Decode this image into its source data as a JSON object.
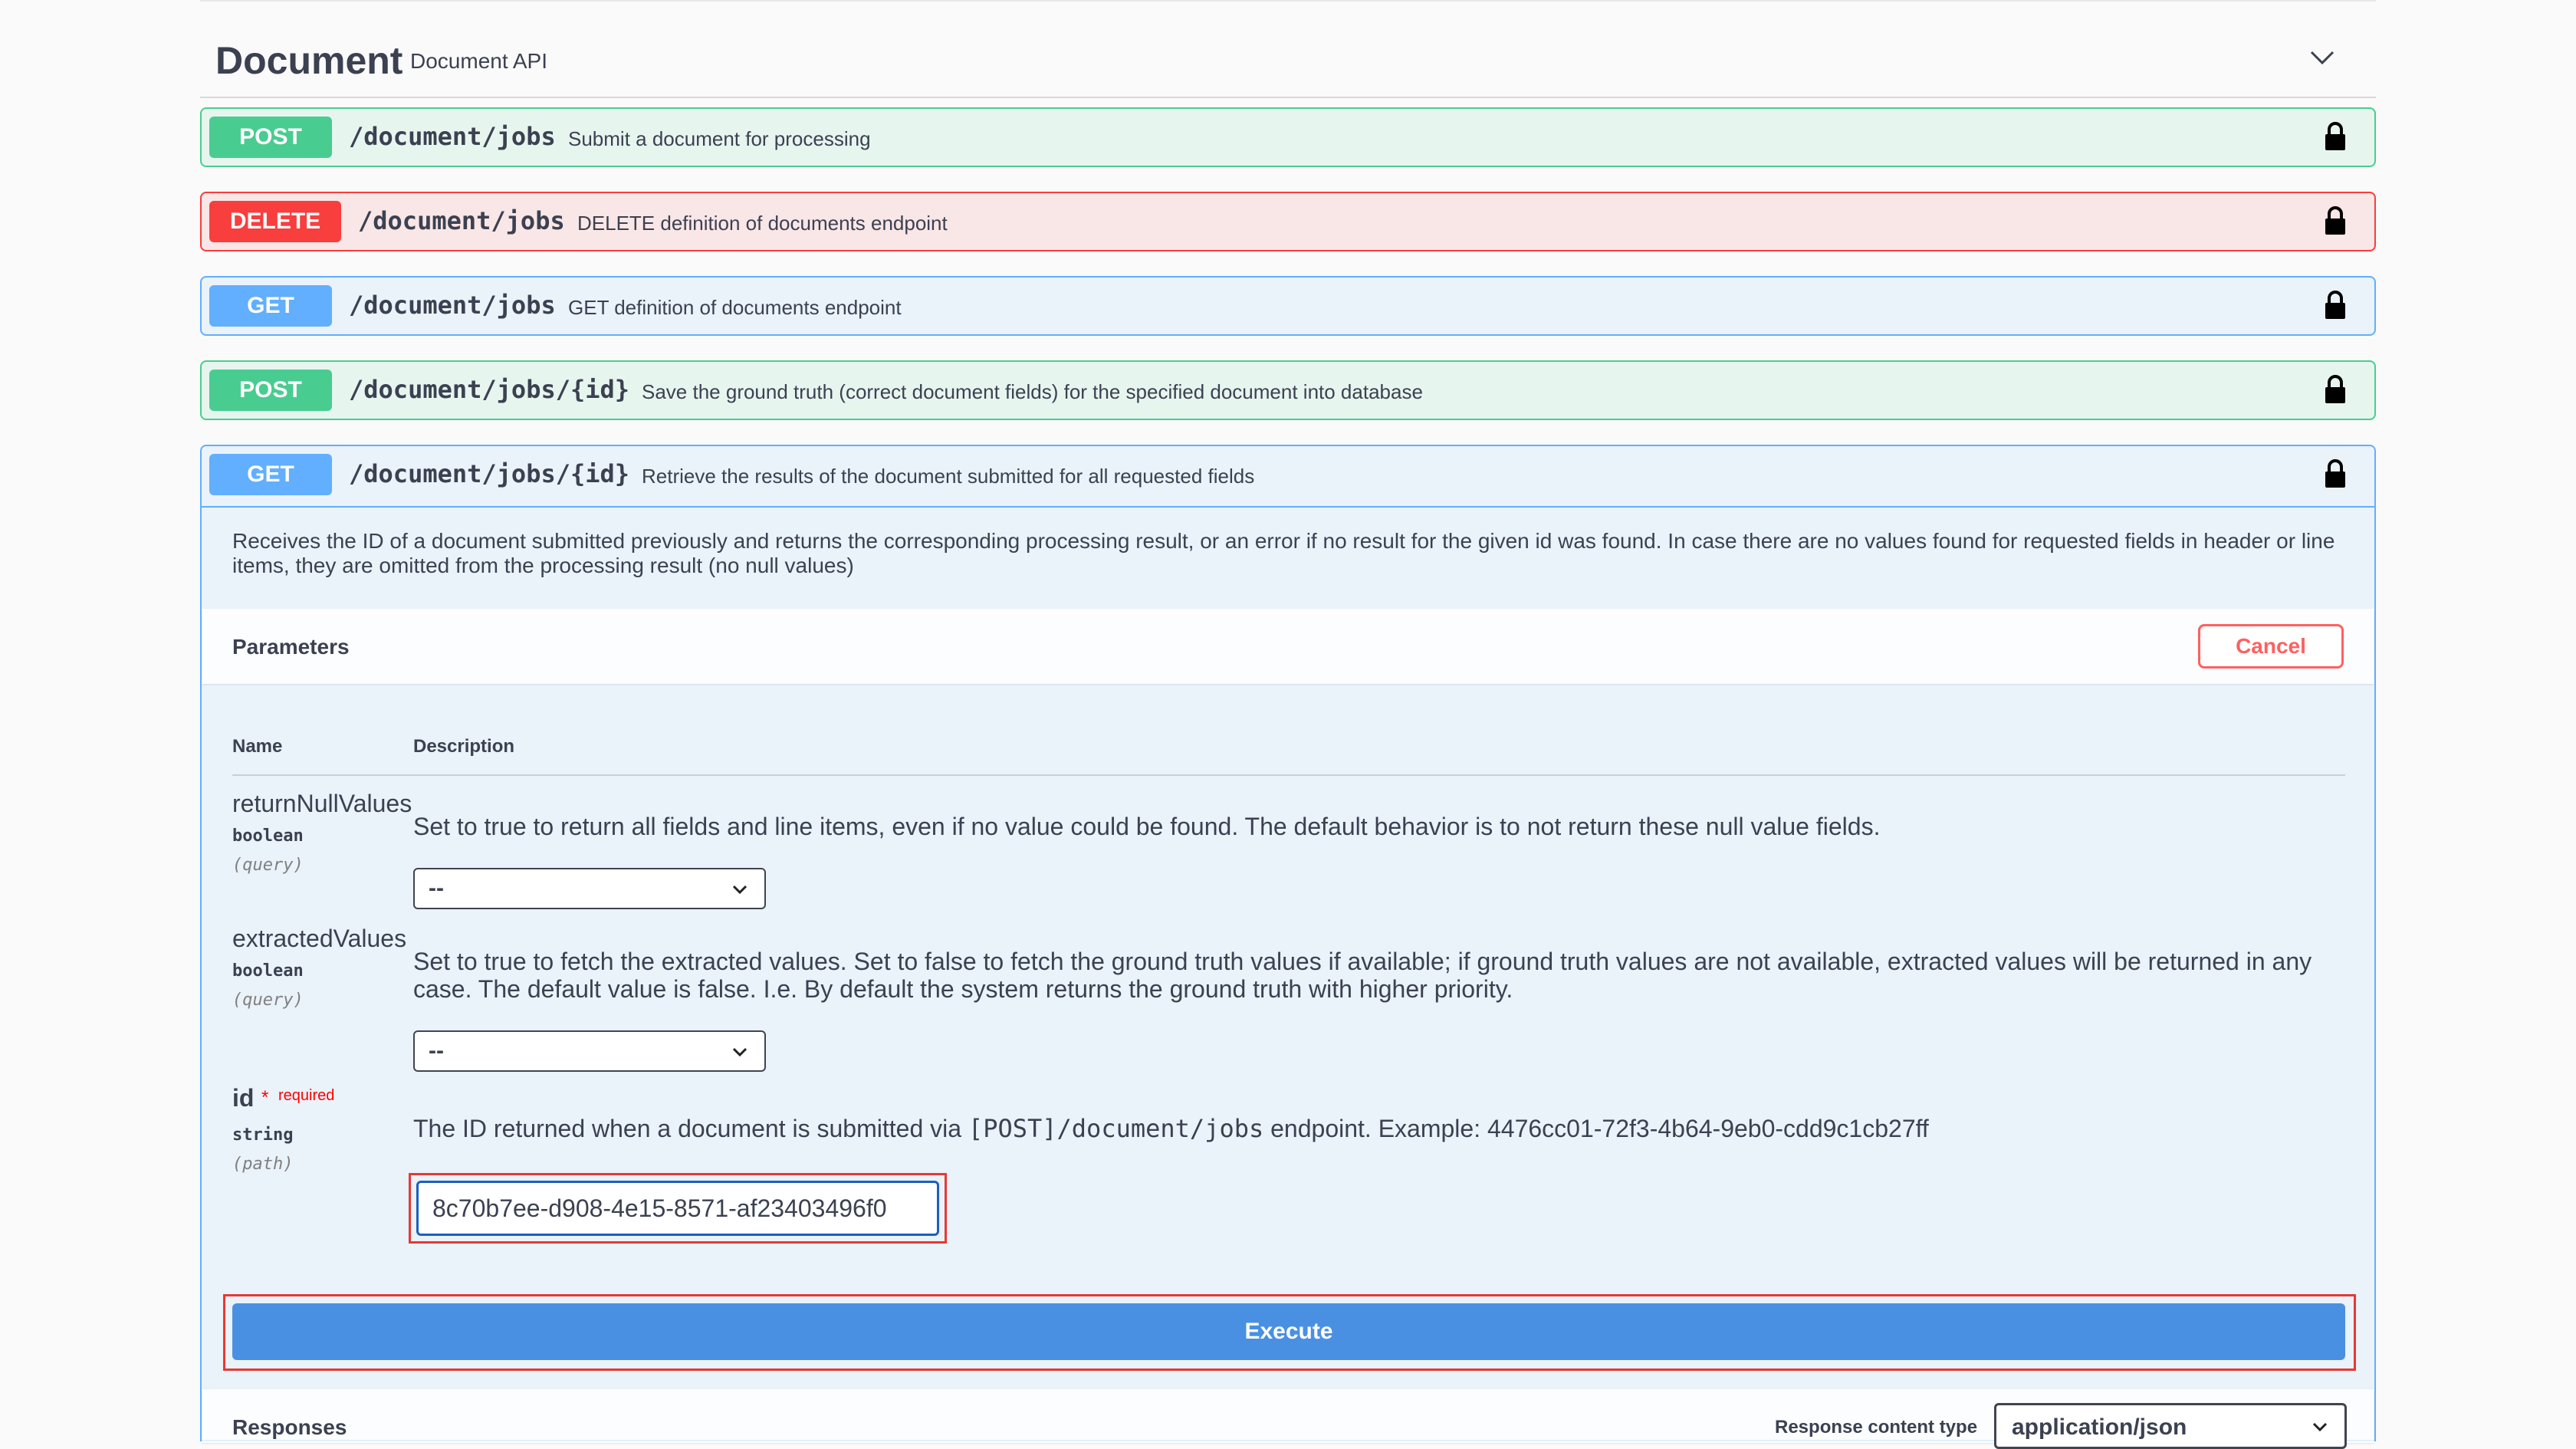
{
  "tag": {
    "name": "Document",
    "description": "Document API"
  },
  "operations": [
    {
      "method": "POST",
      "path": "/document/jobs",
      "summary": "Submit a document for processing"
    },
    {
      "method": "DELETE",
      "path": "/document/jobs",
      "summary": "DELETE definition of documents endpoint"
    },
    {
      "method": "GET",
      "path": "/document/jobs",
      "summary": "GET definition of documents endpoint"
    },
    {
      "method": "POST",
      "path": "/document/jobs/{id}",
      "summary": "Save the ground truth (correct document fields) for the specified document into database"
    },
    {
      "method": "GET",
      "path": "/document/jobs/{id}",
      "summary": "Retrieve the results of the document submitted for all requested fields"
    }
  ],
  "expanded": {
    "description": "Receives the ID of a document submitted previously and returns the corresponding processing result, or an error if no result for the given id was found. In case there are no values found for requested fields in header or line items, they are omitted from the processing result (no null values)",
    "parameters_title": "Parameters",
    "cancel_label": "Cancel",
    "col_name": "Name",
    "col_description": "Description",
    "params": [
      {
        "name": "returnNullValues",
        "type": "boolean",
        "in": "(query)",
        "description": "Set to true to return all fields and line items, even if no value could be found. The default behavior is to not return these null value fields.",
        "selected": "--"
      },
      {
        "name": "extractedValues",
        "type": "boolean",
        "in": "(query)",
        "description": "Set to true to fetch the extracted values. Set to false to fetch the ground truth values if available; if ground truth values are not available, extracted values will be returned in any case. The default value is false. I.e. By default the system returns the ground truth with higher priority.",
        "selected": "--"
      },
      {
        "name": "id",
        "required_star": "*",
        "required_label": "required",
        "type": "string",
        "in": "(path)",
        "description_pre": "The ID returned when a document is submitted via ",
        "description_code": "[POST]/document/jobs",
        "description_post": " endpoint. Example: 4476cc01-72f3-4b64-9eb0-cdd9c1cb27ff",
        "value": "8c70b7ee-d908-4e15-8571-af23403496f0"
      }
    ],
    "execute_label": "Execute",
    "responses_title": "Responses",
    "response_content_type_label": "Response content type",
    "response_content_type_value": "application/json"
  },
  "colors": {
    "post": "#49cc90",
    "delete": "#f93e3e",
    "get": "#61affe",
    "execute": "#4990e2",
    "highlight": "#e53935"
  },
  "icons": {
    "lock": "lock-icon",
    "chevron": "chevron-down-icon"
  }
}
